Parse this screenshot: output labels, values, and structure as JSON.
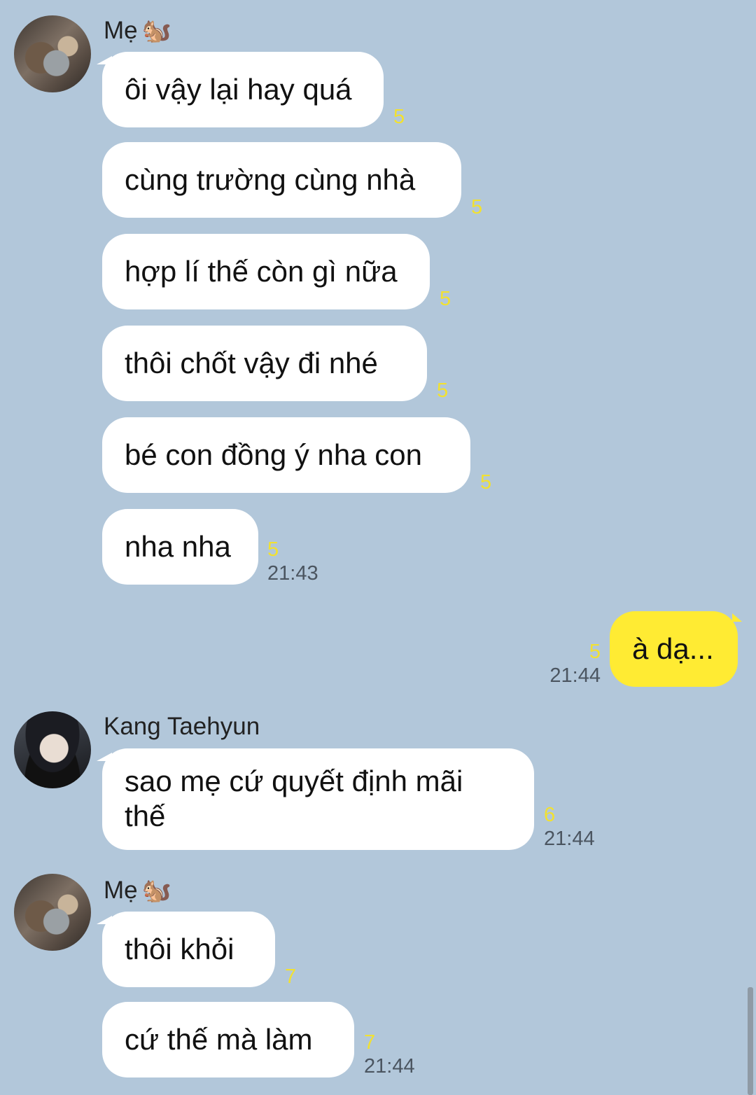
{
  "groups": [
    {
      "sender": "Mẹ",
      "avatar_icon": "squirrel-icon",
      "messages": [
        {
          "text": "ôi vậy lại hay quá",
          "unread": "5"
        },
        {
          "text": "cùng trường cùng nhà",
          "unread": "5"
        },
        {
          "text": "hợp lí thế còn gì nữa",
          "unread": "5"
        },
        {
          "text": "thôi chốt vậy đi nhé",
          "unread": "5"
        },
        {
          "text": "bé con đồng ý nha con",
          "unread": "5"
        },
        {
          "text": "nha nha",
          "unread": "5",
          "time": "21:43"
        }
      ]
    },
    {
      "sender": "me",
      "messages": [
        {
          "text": "à dạ...",
          "unread": "5",
          "time": "21:44"
        }
      ]
    },
    {
      "sender": "Kang Taehyun",
      "messages": [
        {
          "text": "sao mẹ cứ quyết định mãi thế",
          "unread": "6",
          "time": "21:44"
        }
      ]
    },
    {
      "sender": "Mẹ",
      "avatar_icon": "squirrel-icon",
      "messages": [
        {
          "text": "thôi khỏi",
          "unread": "7"
        },
        {
          "text": "cứ thế mà làm",
          "unread": "7",
          "time": "21:44"
        }
      ]
    }
  ],
  "colors": {
    "background": "#b2c7da",
    "incoming_bubble": "#ffffff",
    "outgoing_bubble": "#ffeb33",
    "unread_count": "#f2e130"
  },
  "squirrel_glyph": "🐿️"
}
